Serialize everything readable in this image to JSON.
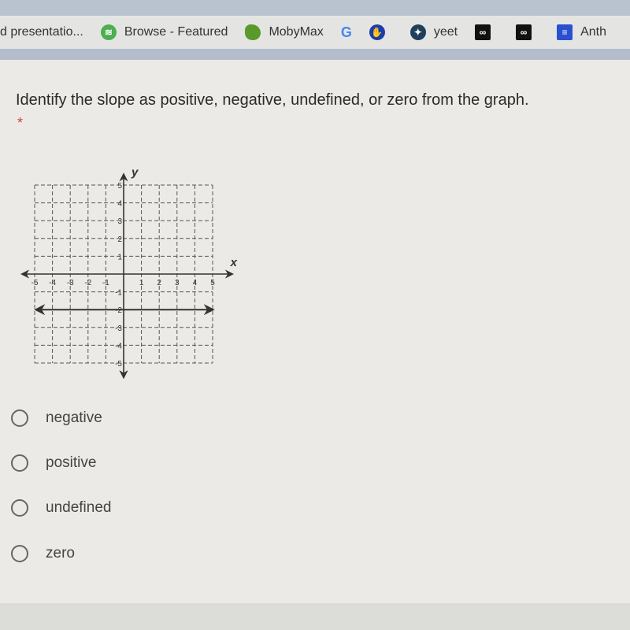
{
  "bookmarks": [
    {
      "label": "d presentatio...",
      "icon": "doc-icon"
    },
    {
      "label": "Browse - Featured",
      "icon": "spotify-icon",
      "color": "#4caf50"
    },
    {
      "label": "MobyMax",
      "icon": "mobymax-icon",
      "color": "#5a9a2a"
    },
    {
      "label": "",
      "icon": "google-icon"
    },
    {
      "label": "",
      "icon": "hand-icon",
      "color": "#1a3fa8"
    },
    {
      "label": "yeet",
      "icon": "compass-icon",
      "color": "#1f3f5a"
    },
    {
      "label": "",
      "icon": "mask-icon"
    },
    {
      "label": "",
      "icon": "mask-icon"
    },
    {
      "label": "Anth",
      "icon": "docs-icon",
      "color": "#2a4fd0"
    }
  ],
  "question": {
    "text": "Identify the slope as positive, negative, undefined, or zero from the graph.",
    "required_marker": "*"
  },
  "chart_data": {
    "type": "line",
    "xlabel": "x",
    "ylabel": "y",
    "xlim": [
      -5,
      5
    ],
    "ylim": [
      -5,
      5
    ],
    "grid": true,
    "x_ticks": [
      "-5",
      "-4",
      "-3",
      "-2",
      "-1",
      "1",
      "2",
      "3",
      "4",
      "5"
    ],
    "y_ticks": [
      "5",
      "4",
      "3",
      "2",
      "1",
      "-1",
      "-2",
      "-3",
      "-4",
      "-5"
    ],
    "series": [
      {
        "x": [
          -5,
          5
        ],
        "y": [
          -2,
          -2
        ]
      }
    ]
  },
  "options": [
    {
      "label": "negative"
    },
    {
      "label": "positive"
    },
    {
      "label": "undefined"
    },
    {
      "label": "zero"
    }
  ]
}
